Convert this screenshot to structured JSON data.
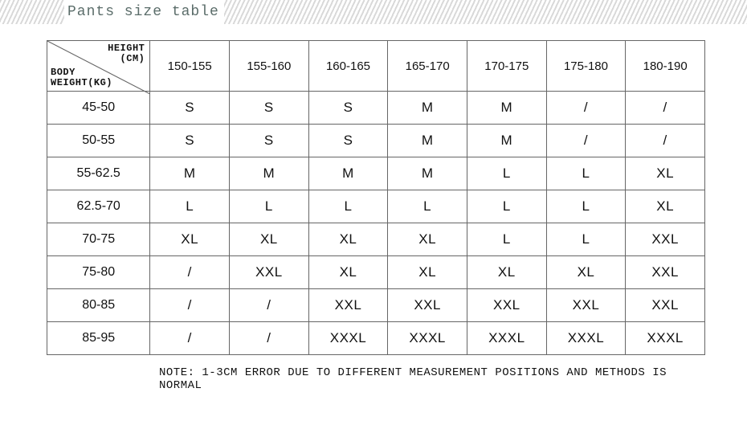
{
  "header": {
    "title": "Pants size table"
  },
  "corner": {
    "height_label": "HEIGHT",
    "height_unit": "(CM)",
    "weight_label": "BODY",
    "weight_label2": "WEIGHT(KG)"
  },
  "chart_data": {
    "type": "table",
    "title": "Pants size table",
    "columns": [
      "150-155",
      "155-160",
      "160-165",
      "165-170",
      "170-175",
      "175-180",
      "180-190"
    ],
    "rows": [
      {
        "label": "45-50",
        "cells": [
          "S",
          "S",
          "S",
          "M",
          "M",
          "/",
          "/"
        ]
      },
      {
        "label": "50-55",
        "cells": [
          "S",
          "S",
          "S",
          "M",
          "M",
          "/",
          "/"
        ]
      },
      {
        "label": "55-62.5",
        "cells": [
          "M",
          "M",
          "M",
          "M",
          "L",
          "L",
          "XL"
        ]
      },
      {
        "label": "62.5-70",
        "cells": [
          "L",
          "L",
          "L",
          "L",
          "L",
          "L",
          "XL"
        ]
      },
      {
        "label": "70-75",
        "cells": [
          "XL",
          "XL",
          "XL",
          "XL",
          "L",
          "L",
          "XXL"
        ]
      },
      {
        "label": "75-80",
        "cells": [
          "/",
          "XXL",
          "XL",
          "XL",
          "XL",
          "XL",
          "XXL"
        ]
      },
      {
        "label": "80-85",
        "cells": [
          "/",
          "/",
          "XXL",
          "XXL",
          "XXL",
          "XXL",
          "XXL"
        ]
      },
      {
        "label": "85-95",
        "cells": [
          "/",
          "/",
          "XXXL",
          "XXXL",
          "XXXL",
          "XXXL",
          "XXXL"
        ]
      }
    ]
  },
  "note": "NOTE: 1-3CM ERROR DUE TO DIFFERENT MEASUREMENT POSITIONS AND METHODS IS NORMAL"
}
